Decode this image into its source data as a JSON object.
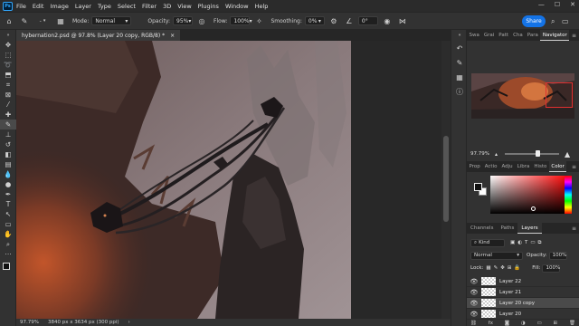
{
  "app": {
    "logo": "Ps"
  },
  "menu": [
    "File",
    "Edit",
    "Image",
    "Layer",
    "Type",
    "Select",
    "Filter",
    "3D",
    "View",
    "Plugins",
    "Window",
    "Help"
  ],
  "window_controls": {
    "minimize": "—",
    "maximize": "☐",
    "close": "✕"
  },
  "options": {
    "brush_size": "-",
    "mode_label": "Mode:",
    "mode_value": "Normal",
    "opacity_label": "Opacity:",
    "opacity_value": "95%",
    "flow_label": "Flow:",
    "flow_value": "100%",
    "smoothing_label": "Smoothing:",
    "smoothing_value": "0%",
    "angle_value": "0°",
    "share_label": "Share"
  },
  "document": {
    "tab_title": "hybernation2.psd @ 97.8% (Layer 20 copy, RGB/8) *",
    "close": "×"
  },
  "status": {
    "zoom": "97.79%",
    "dimensions": "3840 px x 3634 px (300 ppi)"
  },
  "panels": {
    "top_tabs": [
      "Swa",
      "Grai",
      "Patt",
      "Cha",
      "Para",
      "Navigator"
    ],
    "nav_zoom": "97.79%",
    "nav_zoom_level": 0.62,
    "mid_tabs": [
      "Prop",
      "Actio",
      "Adju",
      "Libra",
      "Histo",
      "Color"
    ],
    "layer_tabs": [
      "Channels",
      "Paths",
      "Layers"
    ],
    "filter_kind": "Kind",
    "blend_mode": "Normal",
    "opacity_label": "Opacity:",
    "opacity_value": "100%",
    "lock_label": "Lock:",
    "fill_label": "Fill:",
    "fill_value": "100%",
    "layers": [
      {
        "name": "Layer 22",
        "selected": false
      },
      {
        "name": "Layer 21",
        "selected": false
      },
      {
        "name": "Layer 20 copy",
        "selected": true
      },
      {
        "name": "Layer 20",
        "selected": false
      }
    ]
  },
  "colors": {
    "accent": "#1473e6",
    "foreground": "#111111",
    "background": "#ffffff"
  }
}
